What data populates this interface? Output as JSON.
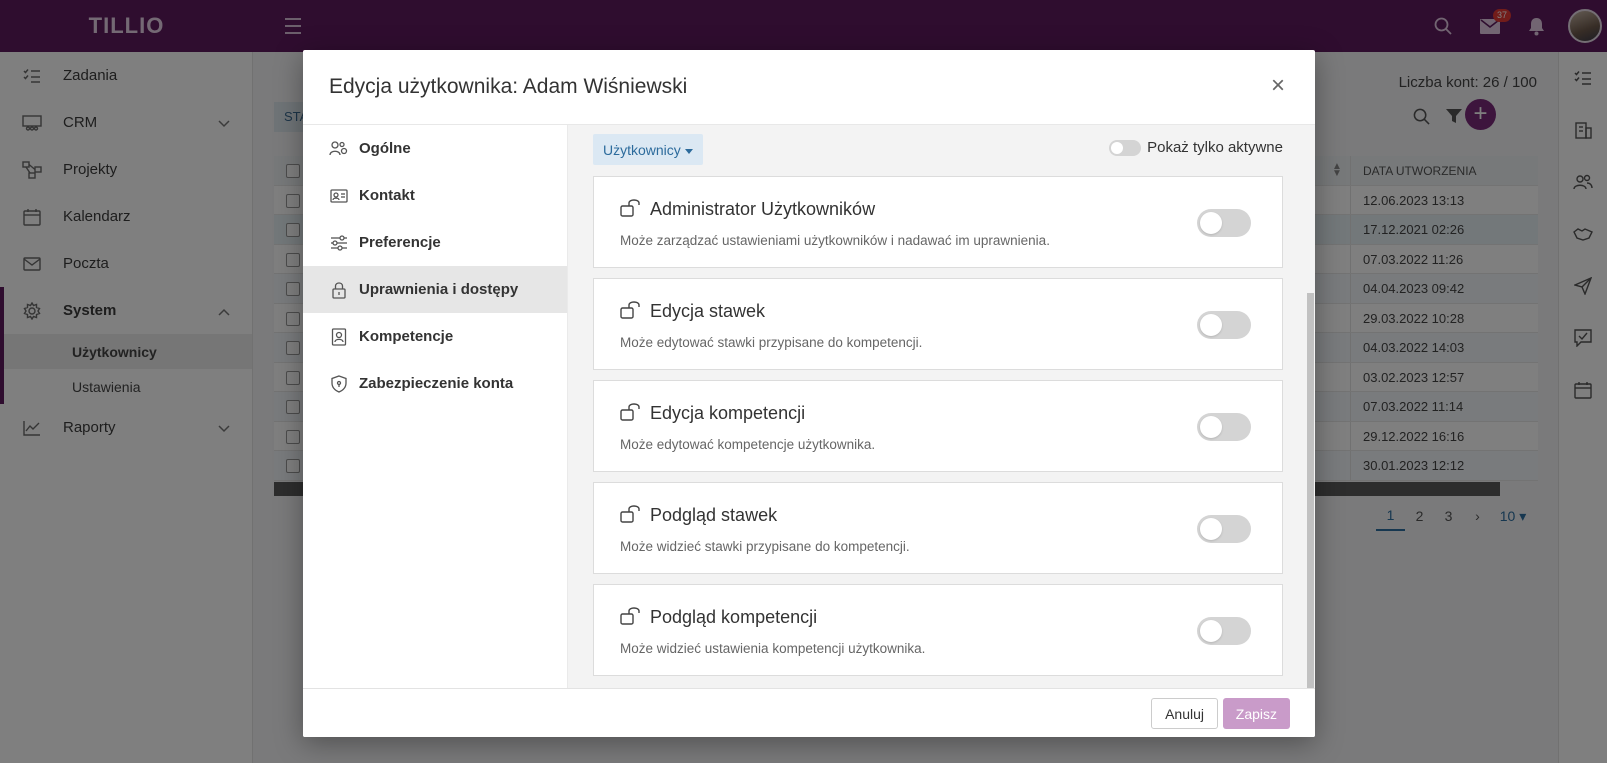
{
  "app": {
    "logo": "TILLIO",
    "mail_badge": "37"
  },
  "sidebar": {
    "items": [
      {
        "label": "Zadania",
        "icon": "tasks-icon"
      },
      {
        "label": "CRM",
        "icon": "crm-icon"
      },
      {
        "label": "Projekty",
        "icon": "projects-icon"
      },
      {
        "label": "Kalendarz",
        "icon": "calendar-icon"
      },
      {
        "label": "Poczta",
        "icon": "mail-icon"
      },
      {
        "label": "System",
        "icon": "gear-icon"
      },
      {
        "label": "Raporty",
        "icon": "chart-icon"
      }
    ],
    "sub_items": [
      {
        "label": "Użytkownicy"
      },
      {
        "label": "Ustawienia"
      }
    ]
  },
  "main": {
    "accounts_count": "Liczba kont: 26 / 100",
    "status_tab": "STA",
    "date_header": "DATA UTWORZENIA",
    "dates": [
      "12.06.2023 13:13",
      "17.12.2021 02:26",
      "07.03.2022 11:26",
      "04.04.2023 09:42",
      "29.03.2022 10:28",
      "04.03.2022 14:03",
      "03.02.2023 12:57",
      "07.03.2022 11:14",
      "29.12.2022 16:16",
      "30.01.2023 12:12"
    ],
    "pager": {
      "p1": "1",
      "p2": "2",
      "p3": "3",
      "next": "›",
      "page_size": "10"
    }
  },
  "modal": {
    "title": "Edycja użytkownika: Adam Wiśniewski",
    "close": "×",
    "menu": [
      {
        "label": "Ogólne",
        "icon": "users-gear-icon"
      },
      {
        "label": "Kontakt",
        "icon": "contact-card-icon"
      },
      {
        "label": "Preferencje",
        "icon": "sliders-icon"
      },
      {
        "label": "Uprawnienia i dostępy",
        "icon": "lock-icon"
      },
      {
        "label": "Kompetencje",
        "icon": "badge-icon"
      },
      {
        "label": "Zabezpieczenie konta",
        "icon": "shield-icon"
      }
    ],
    "dropdown_label": "Użytkownicy",
    "active_only_label": "Pokaż tylko aktywne",
    "permissions": [
      {
        "title": "Administrator Użytkowników",
        "desc": "Może zarządzać ustawieniami użytkowników i nadawać im uprawnienia.",
        "enabled": false
      },
      {
        "title": "Edycja stawek",
        "desc": "Może edytować stawki przypisane do kompetencji.",
        "enabled": false
      },
      {
        "title": "Edycja kompetencji",
        "desc": "Może edytować kompetencje użytkownika.",
        "enabled": false
      },
      {
        "title": "Podgląd stawek",
        "desc": "Może widzieć stawki przypisane do kompetencji.",
        "enabled": false
      },
      {
        "title": "Podgląd kompetencji",
        "desc": "Może widzieć ustawienia kompetencji użytkownika.",
        "enabled": false
      }
    ],
    "cancel_label": "Anuluj",
    "save_label": "Zapisz"
  },
  "colors": {
    "brand": "#5e1a5e",
    "save_button": "#c99bc9",
    "link_blue": "#2c6b9c"
  }
}
